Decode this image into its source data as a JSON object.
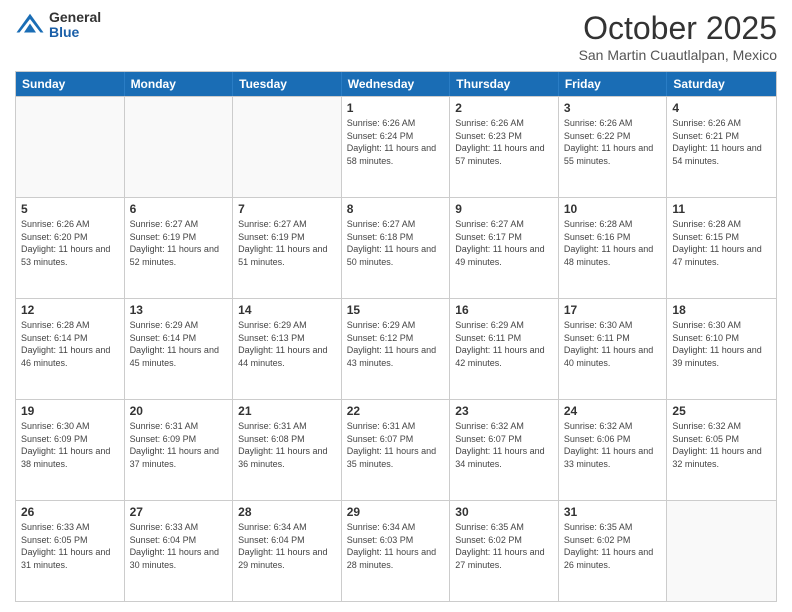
{
  "header": {
    "logo_general": "General",
    "logo_blue": "Blue",
    "month_title": "October 2025",
    "subtitle": "San Martin Cuautlalpan, Mexico"
  },
  "days_of_week": [
    "Sunday",
    "Monday",
    "Tuesday",
    "Wednesday",
    "Thursday",
    "Friday",
    "Saturday"
  ],
  "rows": [
    {
      "cells": [
        {
          "empty": true
        },
        {
          "empty": true
        },
        {
          "empty": true
        },
        {
          "day": 1,
          "sunrise": "6:26 AM",
          "sunset": "6:24 PM",
          "daylight": "11 hours and 58 minutes."
        },
        {
          "day": 2,
          "sunrise": "6:26 AM",
          "sunset": "6:23 PM",
          "daylight": "11 hours and 57 minutes."
        },
        {
          "day": 3,
          "sunrise": "6:26 AM",
          "sunset": "6:22 PM",
          "daylight": "11 hours and 55 minutes."
        },
        {
          "day": 4,
          "sunrise": "6:26 AM",
          "sunset": "6:21 PM",
          "daylight": "11 hours and 54 minutes."
        }
      ]
    },
    {
      "cells": [
        {
          "day": 5,
          "sunrise": "6:26 AM",
          "sunset": "6:20 PM",
          "daylight": "11 hours and 53 minutes."
        },
        {
          "day": 6,
          "sunrise": "6:27 AM",
          "sunset": "6:19 PM",
          "daylight": "11 hours and 52 minutes."
        },
        {
          "day": 7,
          "sunrise": "6:27 AM",
          "sunset": "6:19 PM",
          "daylight": "11 hours and 51 minutes."
        },
        {
          "day": 8,
          "sunrise": "6:27 AM",
          "sunset": "6:18 PM",
          "daylight": "11 hours and 50 minutes."
        },
        {
          "day": 9,
          "sunrise": "6:27 AM",
          "sunset": "6:17 PM",
          "daylight": "11 hours and 49 minutes."
        },
        {
          "day": 10,
          "sunrise": "6:28 AM",
          "sunset": "6:16 PM",
          "daylight": "11 hours and 48 minutes."
        },
        {
          "day": 11,
          "sunrise": "6:28 AM",
          "sunset": "6:15 PM",
          "daylight": "11 hours and 47 minutes."
        }
      ]
    },
    {
      "cells": [
        {
          "day": 12,
          "sunrise": "6:28 AM",
          "sunset": "6:14 PM",
          "daylight": "11 hours and 46 minutes."
        },
        {
          "day": 13,
          "sunrise": "6:29 AM",
          "sunset": "6:14 PM",
          "daylight": "11 hours and 45 minutes."
        },
        {
          "day": 14,
          "sunrise": "6:29 AM",
          "sunset": "6:13 PM",
          "daylight": "11 hours and 44 minutes."
        },
        {
          "day": 15,
          "sunrise": "6:29 AM",
          "sunset": "6:12 PM",
          "daylight": "11 hours and 43 minutes."
        },
        {
          "day": 16,
          "sunrise": "6:29 AM",
          "sunset": "6:11 PM",
          "daylight": "11 hours and 42 minutes."
        },
        {
          "day": 17,
          "sunrise": "6:30 AM",
          "sunset": "6:11 PM",
          "daylight": "11 hours and 40 minutes."
        },
        {
          "day": 18,
          "sunrise": "6:30 AM",
          "sunset": "6:10 PM",
          "daylight": "11 hours and 39 minutes."
        }
      ]
    },
    {
      "cells": [
        {
          "day": 19,
          "sunrise": "6:30 AM",
          "sunset": "6:09 PM",
          "daylight": "11 hours and 38 minutes."
        },
        {
          "day": 20,
          "sunrise": "6:31 AM",
          "sunset": "6:09 PM",
          "daylight": "11 hours and 37 minutes."
        },
        {
          "day": 21,
          "sunrise": "6:31 AM",
          "sunset": "6:08 PM",
          "daylight": "11 hours and 36 minutes."
        },
        {
          "day": 22,
          "sunrise": "6:31 AM",
          "sunset": "6:07 PM",
          "daylight": "11 hours and 35 minutes."
        },
        {
          "day": 23,
          "sunrise": "6:32 AM",
          "sunset": "6:07 PM",
          "daylight": "11 hours and 34 minutes."
        },
        {
          "day": 24,
          "sunrise": "6:32 AM",
          "sunset": "6:06 PM",
          "daylight": "11 hours and 33 minutes."
        },
        {
          "day": 25,
          "sunrise": "6:32 AM",
          "sunset": "6:05 PM",
          "daylight": "11 hours and 32 minutes."
        }
      ]
    },
    {
      "cells": [
        {
          "day": 26,
          "sunrise": "6:33 AM",
          "sunset": "6:05 PM",
          "daylight": "11 hours and 31 minutes."
        },
        {
          "day": 27,
          "sunrise": "6:33 AM",
          "sunset": "6:04 PM",
          "daylight": "11 hours and 30 minutes."
        },
        {
          "day": 28,
          "sunrise": "6:34 AM",
          "sunset": "6:04 PM",
          "daylight": "11 hours and 29 minutes."
        },
        {
          "day": 29,
          "sunrise": "6:34 AM",
          "sunset": "6:03 PM",
          "daylight": "11 hours and 28 minutes."
        },
        {
          "day": 30,
          "sunrise": "6:35 AM",
          "sunset": "6:02 PM",
          "daylight": "11 hours and 27 minutes."
        },
        {
          "day": 31,
          "sunrise": "6:35 AM",
          "sunset": "6:02 PM",
          "daylight": "11 hours and 26 minutes."
        },
        {
          "empty": true
        }
      ]
    }
  ]
}
